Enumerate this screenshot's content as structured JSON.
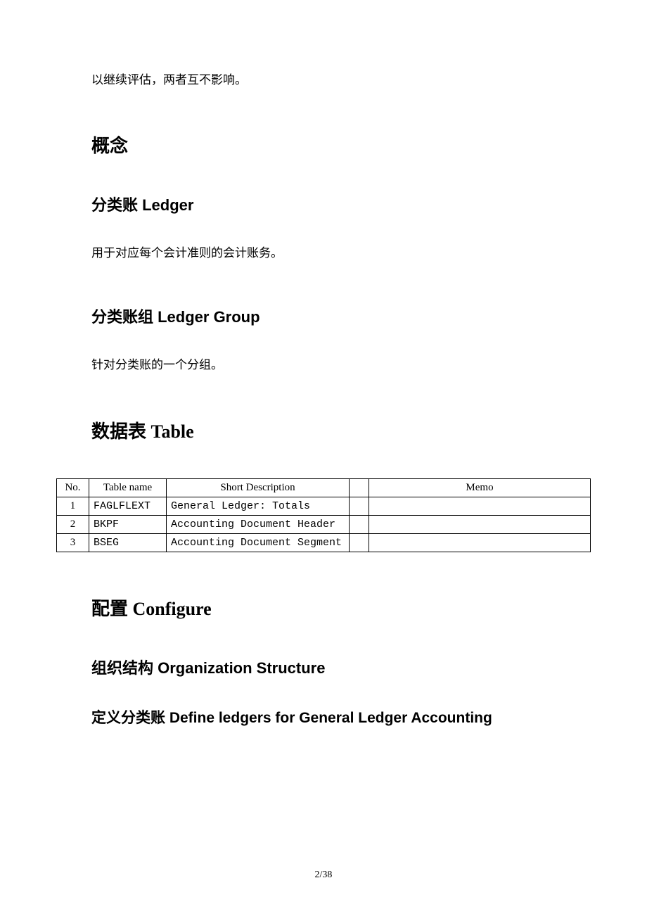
{
  "intro_text": "以继续评估，两者互不影响。",
  "heading_concept": "概念",
  "heading_ledger": "分类账 Ledger",
  "text_ledger": "用于对应每个会计准则的会计账务。",
  "heading_ledger_group": "分类账组 Ledger Group",
  "text_ledger_group": "针对分类账的一个分组。",
  "heading_table": "数据表 Table",
  "table": {
    "headers": {
      "no": "No.",
      "name": "Table name",
      "desc": "Short Description",
      "empty": "",
      "memo": "Memo"
    },
    "rows": [
      {
        "no": "1",
        "name": "FAGLFLEXT",
        "desc": "General Ledger: Totals",
        "empty": "",
        "memo": ""
      },
      {
        "no": "2",
        "name": "BKPF",
        "desc": "Accounting Document Header",
        "empty": "",
        "memo": ""
      },
      {
        "no": "3",
        "name": "BSEG",
        "desc": "Accounting Document Segment",
        "empty": "",
        "memo": ""
      }
    ]
  },
  "heading_configure": "配置 Configure",
  "heading_org_structure": "组织结构 Organization Structure",
  "heading_define_ledgers": "定义分类账 Define ledgers for General Ledger Accounting",
  "page_number": "2/38"
}
